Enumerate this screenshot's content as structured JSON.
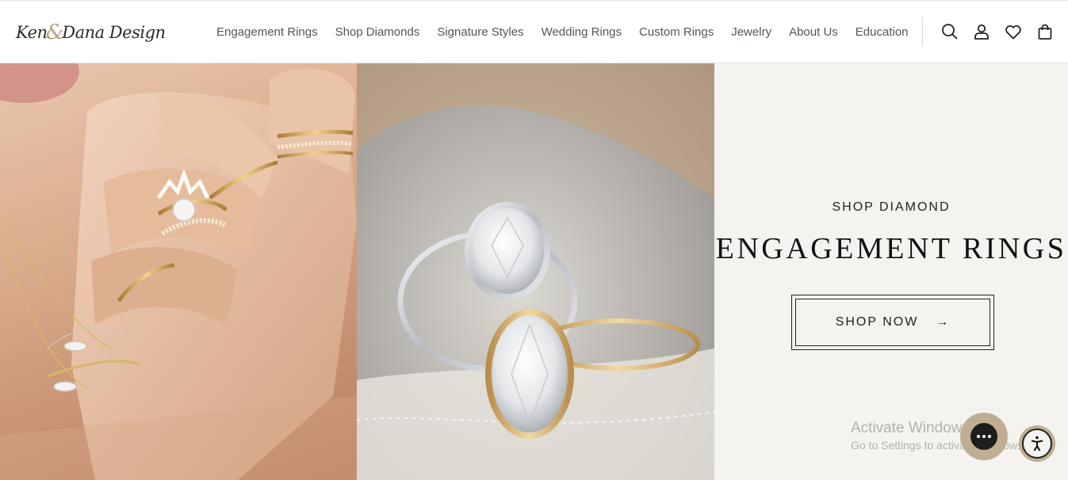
{
  "brand": {
    "logo_part1": "Ken",
    "logo_amp": "&",
    "logo_part2": "Dana Design"
  },
  "nav": {
    "items": [
      {
        "label": "Engagement Rings"
      },
      {
        "label": "Shop Diamonds"
      },
      {
        "label": "Signature Styles"
      },
      {
        "label": "Wedding Rings"
      },
      {
        "label": "Custom Rings"
      },
      {
        "label": "Jewelry"
      },
      {
        "label": "About Us"
      },
      {
        "label": "Education"
      }
    ]
  },
  "header_icons": [
    "search-icon",
    "account-icon",
    "wishlist-heart-icon",
    "shopping-bag-icon"
  ],
  "hero": {
    "eyebrow": "SHOP DIAMOND",
    "headline": "ENGAGEMENT RINGS",
    "cta_label": "SHOP NOW",
    "cta_arrow": "→"
  },
  "watermark": {
    "line1": "Activate Windows",
    "line2": "Go to Settings to activate Windows."
  },
  "colors": {
    "accent_gold": "#bfae93",
    "hero_bg": "#f4f3ef",
    "text_dark": "#111111"
  }
}
